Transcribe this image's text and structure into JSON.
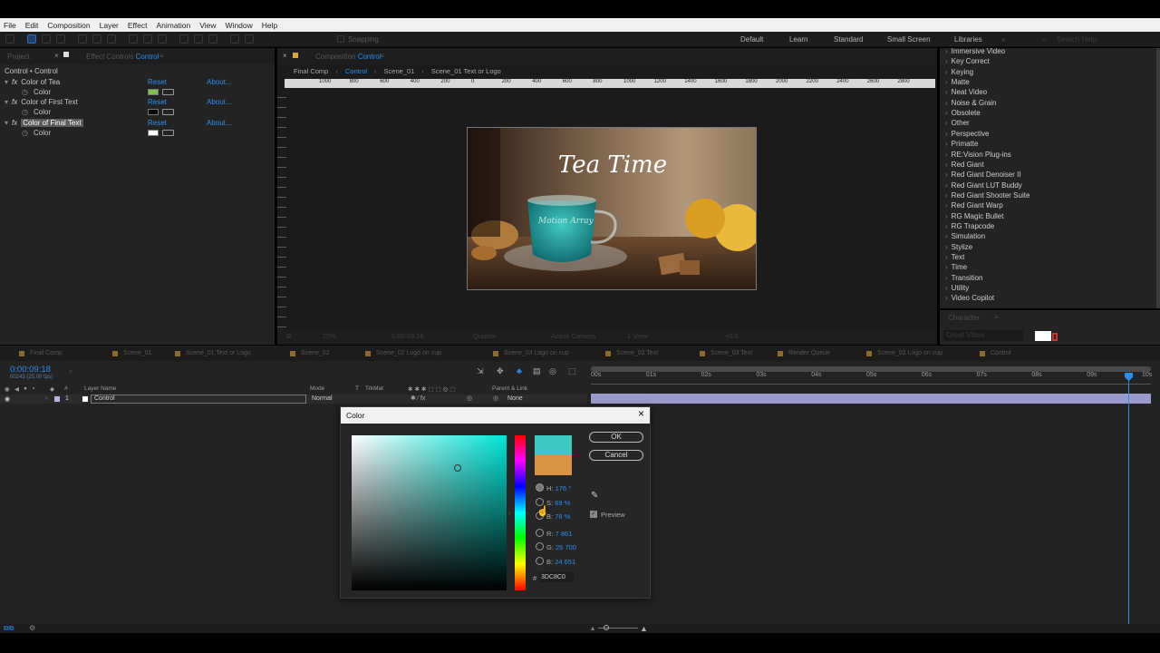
{
  "menu": [
    "File",
    "Edit",
    "Composition",
    "Layer",
    "Effect",
    "Animation",
    "View",
    "Window",
    "Help"
  ],
  "toolbar": {
    "snapping": "Snapping",
    "workspaces": [
      "Default",
      "Learn",
      "Standard",
      "Small Screen",
      "Libraries"
    ],
    "search": "Search Help"
  },
  "left_tabs": {
    "project": "Project",
    "effect_controls": "Effect Controls",
    "effect_controls_target": "Control"
  },
  "effect_controls": {
    "header": "Control • Control",
    "effects": [
      {
        "name": "Color of Tea",
        "reset": "Reset",
        "about": "About...",
        "param": "Color",
        "swatch": "#7ec24c"
      },
      {
        "name": "Color of First Text",
        "reset": "Reset",
        "about": "About...",
        "param": "Color",
        "swatch": "#0a0a0a"
      },
      {
        "name": "Color of Final Text",
        "reset": "Reset",
        "about": "About...",
        "param": "Color",
        "swatch": "#ffffff"
      }
    ]
  },
  "comp_panel": {
    "tab_prefix": "Composition",
    "tab_name": "Control",
    "breadcrumbs": [
      "Final Comp",
      "Control",
      "Scene_01",
      "Scene_01 Text or Logo"
    ],
    "ruler_labels": [
      "1000",
      "800",
      "600",
      "400",
      "200",
      "0",
      "200",
      "400",
      "600",
      "800",
      "1000",
      "1200",
      "1400",
      "1600",
      "1800",
      "2000",
      "2200",
      "2400",
      "2600",
      "2800"
    ],
    "title_text": "Tea Time",
    "cup_text": "Motion Array",
    "footer": {
      "zoom": "25%",
      "time": "0:00:09:18",
      "quality": "Quarter",
      "camera": "Active Camera",
      "view": "1 View",
      "exposure": "+0.0"
    }
  },
  "effects_list": [
    "Immersive Video",
    "Key Correct",
    "Keying",
    "Matte",
    "Neat Video",
    "Noise & Grain",
    "Obsolete",
    "Other",
    "Perspective",
    "Primatte",
    "RE:Vision Plug-ins",
    "Red Giant",
    "Red Giant Denoiser II",
    "Red Giant LUT Buddy",
    "Red Giant Shooter Suite",
    "Red Giant Warp",
    "RG Magic Bullet",
    "RG Trapcode",
    "Simulation",
    "Stylize",
    "Text",
    "Time",
    "Transition",
    "Utility",
    "Video Copilot"
  ],
  "character_panel": {
    "title": "Character",
    "font": "Great Vibes"
  },
  "timeline": {
    "tabs": [
      "Final Comp",
      "Scene_01",
      "Scene_01 Text or Logo",
      "Scene_02",
      "Scene_02 Logo on cup",
      "Scene_03 Logo on cup",
      "Scene_02 Text",
      "Scene_03 Text",
      "Render Queue",
      "Scene_02 Logo on cup",
      "Control"
    ],
    "timecode": "0:00:09:18",
    "timecode_sub": "00243 (25.00 fps)",
    "columns": {
      "layer_name": "Layer Name",
      "mode": "Mode",
      "t": "T",
      "trkmat": "TrkMat",
      "parent": "Parent & Link"
    },
    "layer": {
      "index": "1",
      "name": "Control",
      "mode": "Normal",
      "parent": "None"
    },
    "ticks": [
      "00s",
      "01s",
      "02s",
      "03s",
      "04s",
      "05s",
      "06s",
      "07s",
      "08s",
      "09s",
      "10s"
    ]
  },
  "color_dialog": {
    "title": "Color",
    "ok": "OK",
    "cancel": "Cancel",
    "h_label": "H:",
    "h_value": "176 °",
    "s_label": "S:",
    "s_value": "69 %",
    "b_label": "B:",
    "b_value": "78 %",
    "r_label": "R:",
    "r_value": "7 861",
    "g_label": "G:",
    "g_value": "25 700",
    "bb_label": "B:",
    "bb_value": "24 651",
    "hex_label": "#",
    "hex_value": "3DC8C0",
    "preview_label": "Preview",
    "new_color": "#3dc8c0",
    "old_color": "#d89444"
  }
}
